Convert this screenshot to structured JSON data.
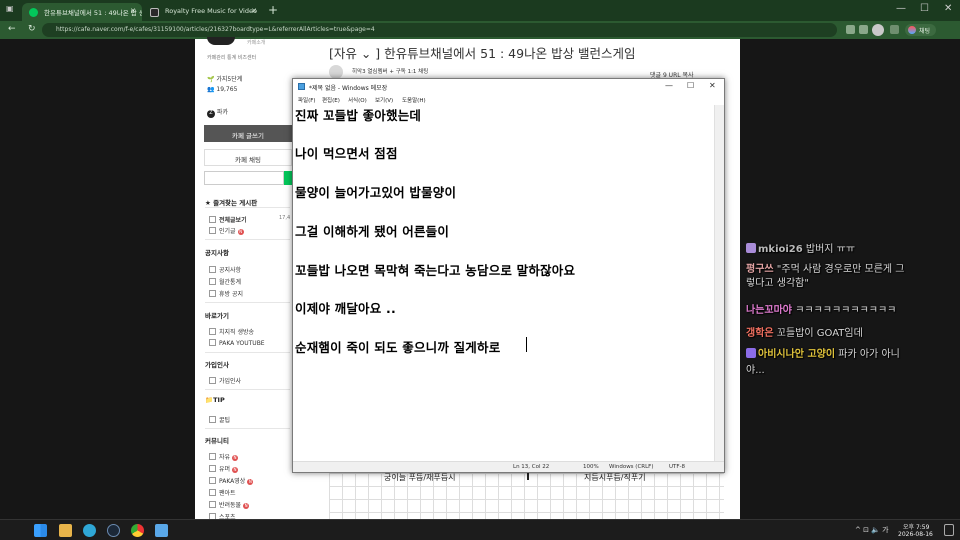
{
  "browser": {
    "tabs": [
      {
        "label": "한유튜브채널에서 51 : 49나온 밥 상",
        "close": "✕"
      },
      {
        "label": "Royalty Free Music for Video",
        "close": "✕"
      }
    ],
    "new_tab": "+",
    "url": "https://cafe.naver.com/f-e/cafes/31159100/articles/216327boardtype=L&referrerAllArticles=true&page=4",
    "chat_button": "채팅",
    "window_controls": {
      "minimize": "—",
      "maximize": "☐",
      "close": "✕"
    }
  },
  "sidebar": {
    "cafe_label": "카페소개",
    "links": "카페관리  통계  비즈센터",
    "level": "가지5단계",
    "members": "19,765",
    "owner": "파카",
    "write_button": "카페 글쓰기",
    "chat_button": "카페 채팅",
    "favorites_head": "즐겨찾는 게시판",
    "all_posts": "전체글보기",
    "all_posts_count": "17,4",
    "popular": "인기글",
    "notice_head": "공지사항",
    "notice_items": [
      "공지사항",
      "월간통계",
      "휴방 공지"
    ],
    "shortcut_head": "바로가기",
    "shortcut_items": [
      "치지직 생방송",
      "PAKA YOUTUBE"
    ],
    "greeting_head": "가입인사",
    "greeting_items": [
      "가입인사"
    ],
    "tip_head": "TIP",
    "tip_items": [
      "꿀팁"
    ],
    "community_head": "커뮤니티",
    "community_items": [
      "자유",
      "유머",
      "PAKA영상",
      "팬아트",
      "반려동물",
      "스포츠"
    ],
    "badge_new": "N"
  },
  "article": {
    "title": "[자유 ⌄ ] 한유튜브채널에서 51 : 49나온 밥상 밸런스게임",
    "writer": "히악3  열심멤버  + 구독  1:1 채팅",
    "comments": "댓글 9   URL 복사",
    "table_col1": "궁이늘 푸듬/재푸듬시",
    "table_col2": "지듬시푸듬/직푸기"
  },
  "notepad": {
    "title": "*제목 없음 - Windows 메모장",
    "menu": [
      "파일(F)",
      "편집(E)",
      "서식(O)",
      "보기(V)",
      "도움말(H)"
    ],
    "lines": [
      "진짜 꼬들밥 좋아했는데",
      "나이 먹으면서 점점",
      "물양이 늘어가고있어 밥물양이",
      "그걸 이해하게 됐어 어른들이",
      "꼬들밥 나오면 목막혀 죽는다고 농담으로 말하잖아요",
      "이제야 깨달아요 ..",
      "순재햄이 죽이 되도 좋으니까 질게하로"
    ],
    "status": {
      "position": "Ln 13, Col 22",
      "zoom": "100%",
      "eol": "Windows (CRLF)",
      "encoding": "UTF-8"
    }
  },
  "stream_chat": [
    {
      "name": "mkioi26",
      "text": "밥버지 ㅠㅠ",
      "color": "#b9b9b9",
      "badge": "#a98cd8"
    },
    {
      "name": "평구쓰",
      "text": "\"주먹 사람 경우로만 모른게 그",
      "color": "#e2a3a3"
    },
    {
      "name": "",
      "text": "렇다고 생각함\"",
      "color": "#d8d8d8"
    },
    {
      "name": "나는꼬마야",
      "text": "ㅋㅋㅋㅋㅋㅋㅋㅋㅋㅋㅋ",
      "color": "#e07cd0"
    },
    {
      "name": "갱학은",
      "text": "꼬들밥이 GOAT임데",
      "color": "#f07060"
    },
    {
      "name": "아비시나안 고양이",
      "text": "파카 아가 아니",
      "color": "#e0c33c",
      "badge": "#8c6de8"
    },
    {
      "name": "",
      "text": "야...",
      "color": "#d8d8d8"
    }
  ],
  "taskbar": {
    "tray": "^ ⊡ 🔈 가",
    "time": "오후 7:59",
    "date": "2026-08-16"
  }
}
